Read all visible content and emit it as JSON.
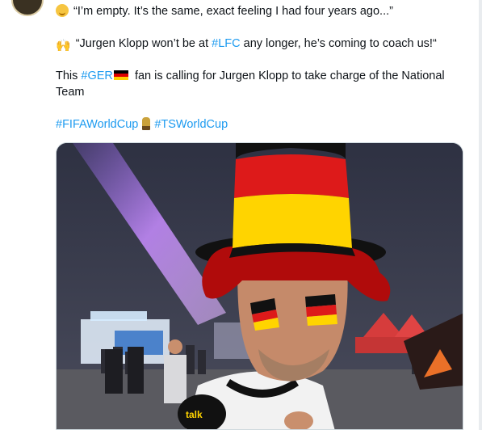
{
  "tweet": {
    "line1": "“I’m empty. It’s the same, exact feeling I had four years ago...”",
    "line2_before": "“Jurgen Klopp won’t be at ",
    "line2_tag": "#LFC",
    "line2_after": " any longer, he’s coming to coach us!“",
    "line3_before": "This ",
    "line3_tag": "#GER",
    "line3_after": " fan is calling for Jurgen Klopp to take charge of the National",
    "line3_cont": "Team",
    "hashtag1": "#FIFAWorldCup",
    "hashtag2": "#TSWorldCup",
    "emojis": [
      "relieved-face",
      "raising-hands",
      "germany-flag",
      "trophy"
    ]
  },
  "media": {
    "type": "video-thumbnail",
    "description": "fan in black-red-gold top hat with painted flags on cheeks",
    "colors": {
      "black": "#111111",
      "red": "#dd1a1a",
      "gold": "#ffd400",
      "night_sky": "#3a3d50",
      "beam": "#c070ff"
    }
  },
  "colors": {
    "link": "#1d9bf0",
    "text": "#0f1419",
    "border": "#cfd9de"
  }
}
